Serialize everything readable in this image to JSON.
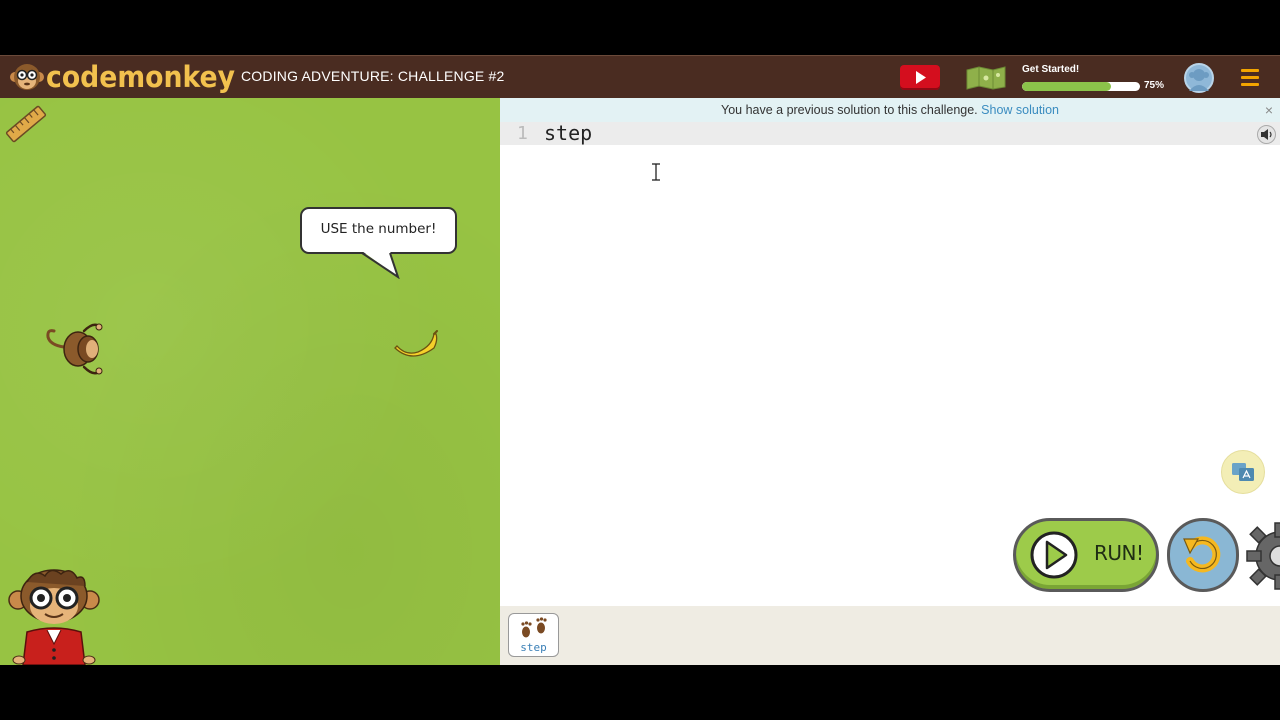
{
  "header": {
    "logo_text": "codemonkey",
    "challenge_title": "CODING ADVENTURE: CHALLENGE #2",
    "progress_label": "Get Started!",
    "progress_value": 0.75,
    "progress_pct_text": "75%"
  },
  "game": {
    "speech_bubble": "USE the number!"
  },
  "editor": {
    "notice_text": "You have a previous solution to this challenge.",
    "notice_link": "Show solution",
    "notice_close": "×",
    "line_number": "1",
    "code": "step",
    "run_label": "RUN!"
  },
  "commands": {
    "step_label": "step"
  },
  "icons": {
    "video": "play-video-icon",
    "map": "map-icon",
    "avatar": "avatar-icon",
    "menu": "hamburger-menu-icon",
    "ruler": "ruler-icon",
    "sound": "speaker-icon",
    "translate": "translate-icon",
    "reset": "reset-icon",
    "settings": "gear-icon",
    "step": "footprints-icon"
  },
  "colors": {
    "header_bg": "#4a2c21",
    "logo": "#f2c14e",
    "game_bg": "#97c343",
    "run_button": "#9dcb4a",
    "link": "#3a8cc0",
    "video_red": "#d40e1e"
  }
}
